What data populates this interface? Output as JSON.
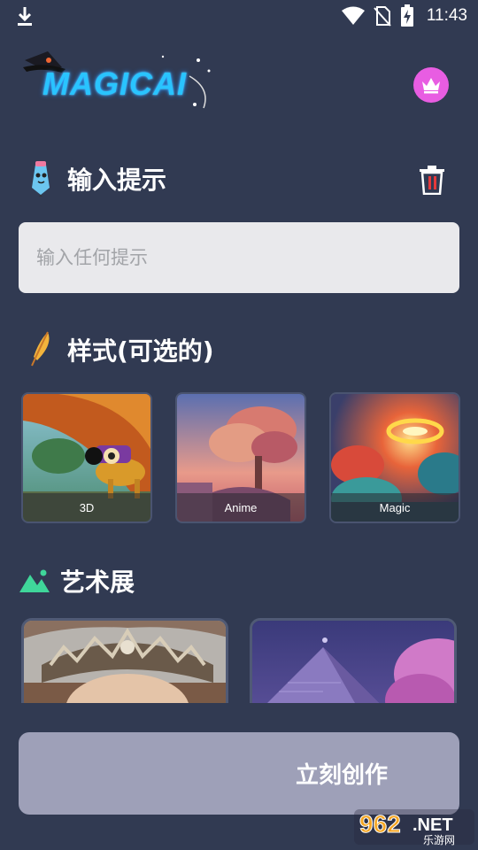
{
  "status_bar": {
    "time": "11:43",
    "icons": [
      "download-icon",
      "wifi-icon",
      "no-sim-icon",
      "battery-charging-icon"
    ]
  },
  "header": {
    "logo_text": "MAGICAI",
    "premium_icon": "crown-icon"
  },
  "prompt_section": {
    "title": "输入提示",
    "icon": "pencil-mascot-icon",
    "clear_icon": "trash-icon",
    "input_placeholder": "输入任何提示",
    "input_value": ""
  },
  "style_section": {
    "title": "样式(可选的)",
    "icon": "feather-icon",
    "styles": [
      {
        "label": "3D"
      },
      {
        "label": "Anime"
      },
      {
        "label": "Magic"
      }
    ]
  },
  "gallery_section": {
    "title": "艺术展",
    "icon": "mountain-icon"
  },
  "create_button": {
    "label": "立刻创作"
  },
  "watermark": {
    "brand": "962.NET",
    "sub": "乐游网"
  },
  "colors": {
    "background": "#313a52",
    "premium": "#e85de2",
    "button": "#9ea0b8",
    "input": "#e9e9ec",
    "accent_green": "#3fd69a"
  }
}
